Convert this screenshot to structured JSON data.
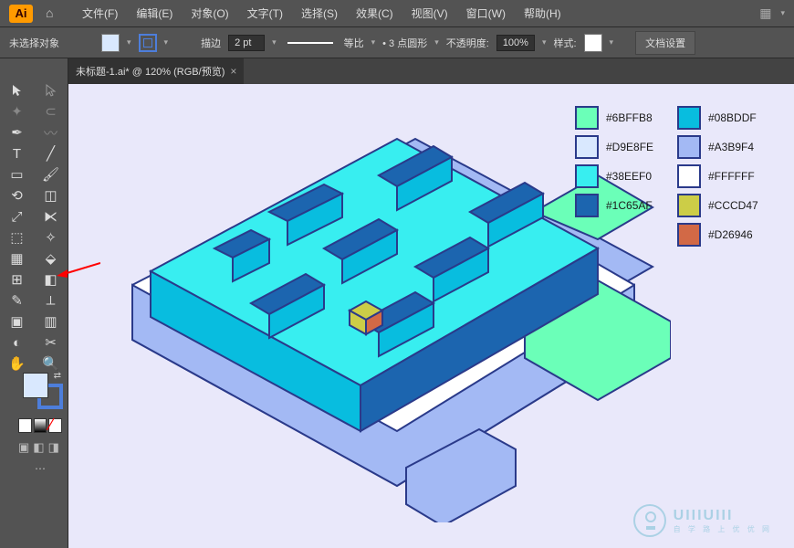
{
  "app": {
    "logo": "Ai"
  },
  "menu": {
    "items": [
      "文件(F)",
      "编辑(E)",
      "对象(O)",
      "文字(T)",
      "选择(S)",
      "效果(C)",
      "视图(V)",
      "窗口(W)",
      "帮助(H)"
    ]
  },
  "control": {
    "status": "未选择对象",
    "stroke_label": "描边",
    "stroke_width": "2 pt",
    "scale_label": "等比",
    "dot_style": "• 3 点圆形",
    "opacity_label": "不透明度:",
    "opacity_value": "100%",
    "style_label": "样式:",
    "doc_setup": "文档设置",
    "fill_color": "#D9E8FE",
    "stroke_color": "#4D7EDB"
  },
  "tab": {
    "title": "未标题-1.ai* @ 120% (RGB/预览)"
  },
  "tools": {
    "left": [
      "selection-tool",
      "direct-selection-tool",
      "pen-tool",
      "curvature-tool",
      "type-tool",
      "line-tool",
      "rectangle-tool",
      "paintbrush-tool",
      "rotate-tool",
      "eraser-tool",
      "scale-tool",
      "width-tool",
      "free-transform-tool",
      "mesh-tool",
      "perspective-grid-tool",
      "shape-builder-tool",
      "eyedropper-tool",
      "measure-tool",
      "artboard-tool",
      "graph-tool",
      "hand-tool",
      "zoom-tool"
    ],
    "right": [
      "magic-wand-tool",
      "lasso-tool",
      "anchor-point-tool",
      "brush-tool",
      "slash-tool",
      "blob-brush-tool",
      "shaper-tool",
      "pencil-tool",
      "reflect-tool",
      "shear-tool",
      "warp-tool",
      "puppet-tool",
      "gradient-tool",
      "wrinkle-tool",
      "live-paint-tool",
      "blend-tool",
      "symbol-sprayer-tool",
      "column-graph-tool",
      "slice-tool",
      "print-tiling-tool",
      "knife-tool",
      "move-tool"
    ]
  },
  "palette": [
    {
      "color": "#6BFFB8",
      "label": "#6BFFB8"
    },
    {
      "color": "#08BDDF",
      "label": "#08BDDF"
    },
    {
      "color": "#D9E8FE",
      "label": "#D9E8FE"
    },
    {
      "color": "#A3B9F4",
      "label": "#A3B9F4"
    },
    {
      "color": "#38EEF0",
      "label": "#38EEF0"
    },
    {
      "color": "#FFFFFF",
      "label": "#FFFFFF"
    },
    {
      "color": "#1C65AF",
      "label": "#1C65AF"
    },
    {
      "color": "#CCCD47",
      "label": "#CCCD47"
    },
    {
      "color": "",
      "label": ""
    },
    {
      "color": "#D26946",
      "label": "#D26946"
    }
  ],
  "watermark": {
    "brand": "UIIIUIII",
    "tagline": "自 学 路 上 优 优 网"
  }
}
